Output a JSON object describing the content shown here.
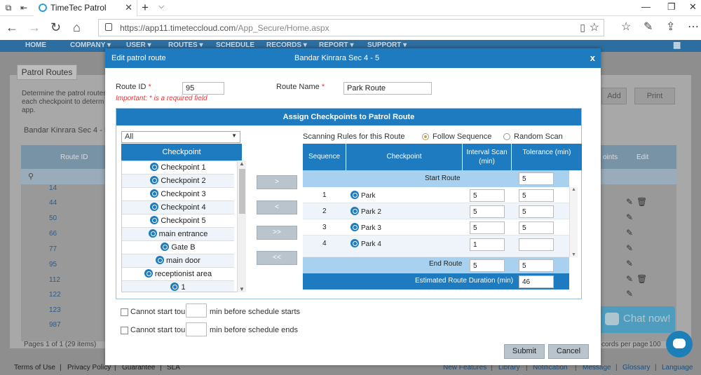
{
  "browser": {
    "tab_title": "TimeTec Patrol",
    "url_host": "https://app11.timeteccloud.com",
    "url_path": "/App_Secure/Home.aspx"
  },
  "app_nav": [
    "HOME",
    "COMPANY ▾",
    "USER ▾",
    "ROUTES ▾",
    "SCHEDULE",
    "RECORDS ▾",
    "REPORT ▾",
    "SUPPORT ▾"
  ],
  "background": {
    "tab_label": "Patrol Routes",
    "desc": [
      "Determine the patrol routes",
      "each checkpoint to determ",
      "app."
    ],
    "route_filter": "Bandar Kinrara Sec 4 - 5",
    "add_label": "Add",
    "print_label": "Print",
    "col_route_id": "Route ID",
    "col_points": "oints",
    "col_edit": "Edit",
    "route_ids": [
      "14",
      "44",
      "50",
      "66",
      "77",
      "95",
      "112",
      "122",
      "123",
      "987"
    ],
    "pages": "Pages 1 of 1 (29 items)",
    "per_page": "cords per page",
    "per_page_val": "100"
  },
  "footer": {
    "left": [
      "Terms of Use",
      "|",
      "Privacy Policy",
      "|",
      "Guarantee",
      "|",
      "SLA"
    ],
    "right": [
      "New Features",
      "|",
      "Library",
      "|",
      "Notification",
      "|",
      "Message",
      "|",
      "Glossary",
      "|",
      "Language"
    ]
  },
  "chat": {
    "label": "Chat now!"
  },
  "modal": {
    "title": "Edit patrol route",
    "center_title": "Bandar Kinrara Sec 4 - 5",
    "close": "x",
    "route_id_label": "Route ID",
    "route_id_value": "95",
    "route_name_label": "Route Name",
    "route_name_value": "Park Route",
    "required_mark": "*",
    "important": "Important: * is a required field",
    "assign_title": "Assign Checkpoints to Patrol Route",
    "filter_value": "All",
    "checkpoint_header": "Checkpoint",
    "checkpoints": [
      "Checkpoint 1",
      "Checkpoint 2",
      "Checkpoint 3",
      "Checkpoint 4",
      "Checkpoint 5",
      "main entrance",
      "Gate B",
      "main door",
      "receptionist area",
      "1"
    ],
    "move_buttons": [
      ">",
      "<",
      ">>",
      "<<"
    ],
    "scanning_rules_label": "Scanning Rules for this Route",
    "follow_sequence": "Follow Sequence",
    "random_scan": "Random Scan",
    "col_sequence": "Sequence",
    "col_checkpoint": "Checkpoint",
    "col_interval": "Interval Scan (min)",
    "col_tolerance": "Tolerance (min)",
    "start_route_label": "Start Route",
    "start_tolerance": "5",
    "rows": [
      {
        "seq": "1",
        "name": "Park",
        "interval": "5",
        "tolerance": "5"
      },
      {
        "seq": "2",
        "name": "Park 2",
        "interval": "5",
        "tolerance": "5"
      },
      {
        "seq": "3",
        "name": "Park 3",
        "interval": "5",
        "tolerance": "5"
      },
      {
        "seq": "4",
        "name": "Park 4",
        "interval": "1",
        "tolerance": ""
      }
    ],
    "end_route_label": "End Route",
    "end_interval": "5",
    "end_tolerance": "5",
    "duration_label": "Estimated Route Duration (min)",
    "duration_value": "46",
    "cannot_start_label": "Cannot start tour",
    "before_start_text": "min before schedule starts",
    "before_end_text": "min before schedule ends",
    "submit": "Submit",
    "cancel": "Cancel"
  }
}
